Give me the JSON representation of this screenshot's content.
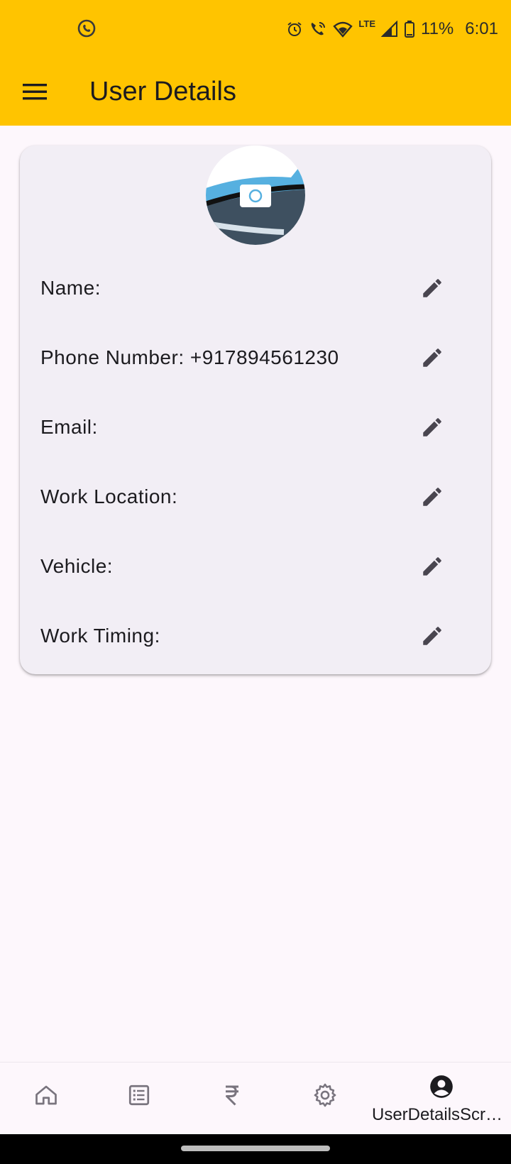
{
  "status_bar": {
    "battery": "11%",
    "time": "6:01",
    "network": "LTE"
  },
  "app_bar": {
    "title": "User Details"
  },
  "user_card": {
    "fields": [
      {
        "label": "Name:"
      },
      {
        "label": "Phone Number: +917894561230"
      },
      {
        "label": "Email:"
      },
      {
        "label": "Work Location:"
      },
      {
        "label": "Vehicle:"
      },
      {
        "label": "Work Timing:"
      }
    ]
  },
  "bottom_nav": {
    "items": [
      {
        "icon": "home-icon",
        "label": ""
      },
      {
        "icon": "list-icon",
        "label": ""
      },
      {
        "icon": "rupee-icon",
        "label": ""
      },
      {
        "icon": "gear-icon",
        "label": ""
      },
      {
        "icon": "account-circle-icon",
        "label": "UserDetailsScre…"
      }
    ]
  },
  "colors": {
    "app_bar": "#ffc400",
    "background": "#fdf7fc",
    "card": "#f2eef5",
    "icon": "#49454f"
  }
}
